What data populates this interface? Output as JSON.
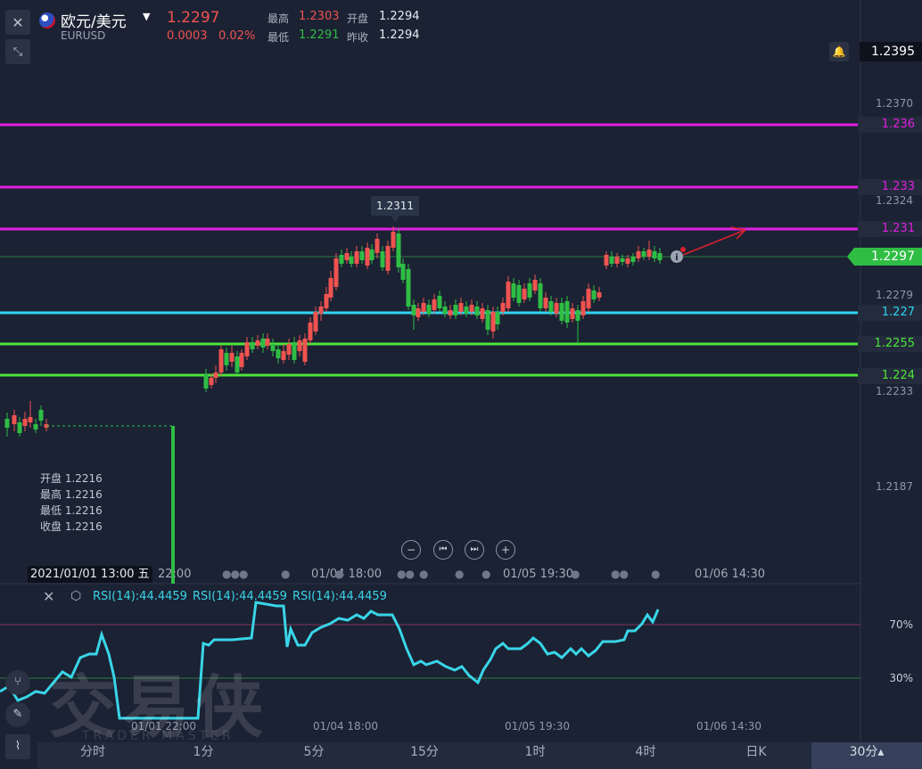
{
  "header": {
    "pair_name": "欧元/美元",
    "pair_code": "EURUSD",
    "last_price": "1.2297",
    "change": "0.0003",
    "change_pct": "0.02%",
    "high_label": "最高",
    "high_value": "1.2303",
    "open_label": "开盘",
    "open_value": "1.2294",
    "low_label": "最低",
    "low_value": "1.2291",
    "prev_close_label": "昨收",
    "prev_close_value": "1.2294",
    "close_icon": "close-icon",
    "collapse_icon": "collapse-arrows-icon",
    "dropdown_icon": "caret-down-icon"
  },
  "price_axis": {
    "top_tag": "1.2395",
    "labels": [
      "1.2370",
      "1.2324",
      "1.2279",
      "1.2233",
      "1.2187"
    ],
    "current_tag": "1.2297",
    "level_tags": [
      {
        "value": "1.236",
        "color": "#e020e0"
      },
      {
        "value": "1.233",
        "color": "#e020e0"
      },
      {
        "value": "1.231",
        "color": "#e020e0"
      },
      {
        "value": "1.227",
        "color": "#2fd4ef"
      },
      {
        "value": "1.2255",
        "color": "#4ee63a"
      },
      {
        "value": "1.224",
        "color": "#4ee63a"
      }
    ],
    "bell_icon": "bell-icon"
  },
  "tooltip": {
    "peak_value": "1.2311"
  },
  "ohlc_panel": {
    "open": "开盘 1.2216",
    "high": "最高 1.2216",
    "low": "最低 1.2216",
    "close": "收盘 1.2216"
  },
  "nav_controls": {
    "zoom_out": "−",
    "prev": "⏮",
    "next": "⏭",
    "zoom_in": "+"
  },
  "time_axis": {
    "crosshair_time": "2021/01/01 13:00 五",
    "labels": [
      "22:00",
      "01/04 18:00",
      "01/05 19:30",
      "01/06 14:30"
    ]
  },
  "rsi_panel": {
    "label1": "RSI(14):44.4459",
    "label2": "RSI(14):44.4459",
    "label3": "RSI(14):44.4459",
    "level_high": "70%",
    "level_low": "30%",
    "time_labels": [
      "01/01 22:00",
      "01/04 18:00",
      "01/05 19:30",
      "01/06 14:30"
    ]
  },
  "watermark": {
    "main": "交易侠",
    "sub": "TRADER MASTER"
  },
  "timeframes": [
    "分时",
    "1分",
    "5分",
    "15分",
    "1时",
    "4时",
    "日K",
    "30分▴"
  ],
  "colors": {
    "bg": "#1b2233",
    "up": "#ef5350",
    "down": "#2fbd44",
    "magenta": "#e020e0",
    "cyan": "#2fd4ef",
    "green": "#4ee63a",
    "rsi": "#39d5e8"
  }
}
